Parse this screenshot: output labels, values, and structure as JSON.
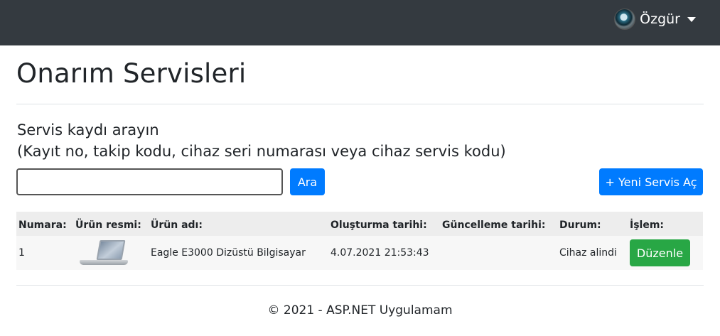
{
  "navbar": {
    "user_name": "Özgür"
  },
  "page": {
    "title": "Onarım Servisleri"
  },
  "search": {
    "label_line1": "Servis kaydı arayın",
    "label_line2": "(Kayıt no, takip kodu, cihaz seri numarası veya cihaz servis kodu)",
    "input_value": "",
    "button_label": "Ara"
  },
  "actions": {
    "new_service_label": "+ Yeni Servis Aç"
  },
  "table": {
    "headers": [
      "Numara:",
      "Ürün resmi:",
      "Ürün adı:",
      "Oluşturma tarihi:",
      "Güncelleme tarihi:",
      "Durum:",
      "İşlem:"
    ],
    "rows": [
      {
        "number": "1",
        "image_icon": "laptop-image",
        "product_name": "Eagle E3000 Dizüstü Bilgisayar",
        "created": "4.07.2021 21:53:43",
        "updated": "",
        "status": "Cihaz alindi",
        "action_label": "Düzenle"
      }
    ]
  },
  "footer": {
    "text": "© 2021 - ASP.NET Uygulamam"
  },
  "colors": {
    "navbar": "#343a40",
    "primary": "#007bff",
    "success": "#28a745"
  }
}
